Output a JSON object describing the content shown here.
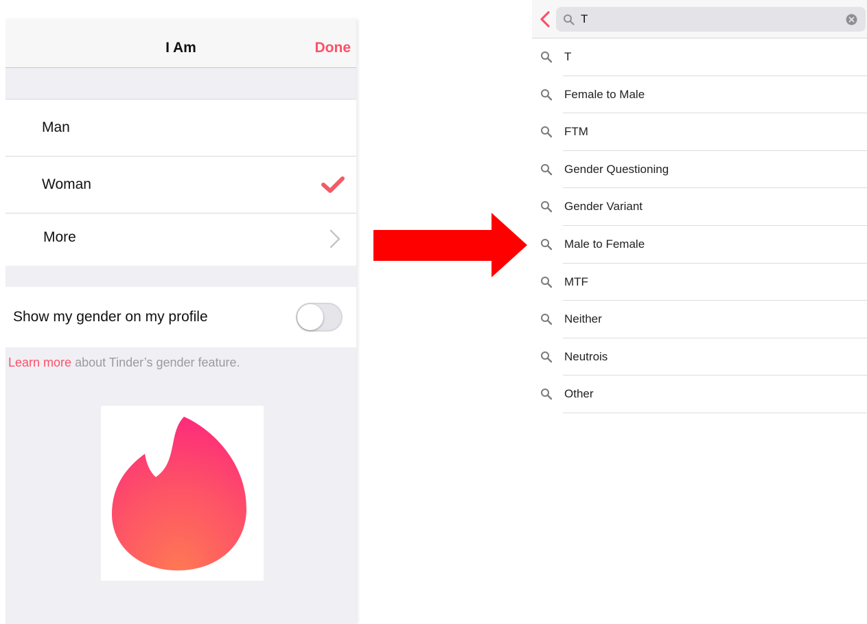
{
  "left": {
    "nav": {
      "title": "I Am",
      "done_label": "Done"
    },
    "gender_options": [
      {
        "label": "Man"
      },
      {
        "label": "Woman",
        "selected": true
      },
      {
        "label": "More",
        "has_chevron": true
      }
    ],
    "toggle": {
      "label": "Show my gender on my profile",
      "on": false
    },
    "footer": {
      "link_text": "Learn more",
      "rest_text": " about Tinder’s gender feature."
    },
    "logo": {
      "icon": "tinder-flame-logo"
    }
  },
  "arrow": {
    "icon": "right-arrow",
    "color": "#ff0000"
  },
  "right": {
    "search": {
      "value": "T"
    },
    "suggestions": [
      "T",
      "Female to Male",
      "FTM",
      "Gender Questioning",
      "Gender Variant",
      "Male to Female",
      "MTF",
      "Neither",
      "Neutrois",
      "Other"
    ]
  },
  "colors": {
    "accent": "#fd5068",
    "arrow": "#ff0000"
  }
}
